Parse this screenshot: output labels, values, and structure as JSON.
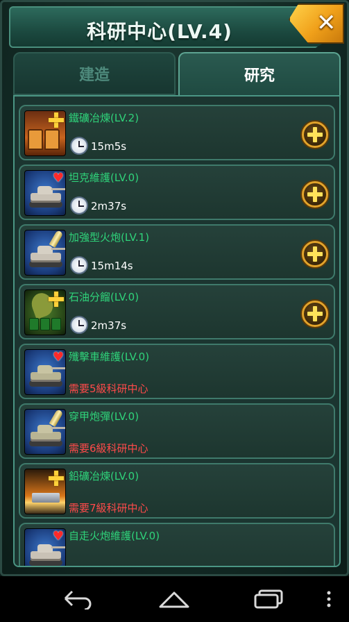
{
  "header": {
    "title": "科研中心(LV.4)",
    "close_icon": "close-icon"
  },
  "tabs": [
    {
      "label": "建造",
      "active": false
    },
    {
      "label": "研究",
      "active": true
    }
  ],
  "items": [
    {
      "name": "鐵礦冶煉(LV.2)",
      "time": "15m5s",
      "requirement": "",
      "icon": "iron-smelting-icon",
      "badge": "plus"
    },
    {
      "name": "坦克維護(LV.0)",
      "time": "2m37s",
      "requirement": "",
      "icon": "tank-icon",
      "badge": "heart"
    },
    {
      "name": "加強型火炮(LV.1)",
      "time": "15m14s",
      "requirement": "",
      "icon": "tank-cannon-icon",
      "badge": "shell"
    },
    {
      "name": "石油分餾(LV.0)",
      "time": "2m37s",
      "requirement": "",
      "icon": "oil-refining-icon",
      "badge": "plus"
    },
    {
      "name": "殲擊車維護(LV.0)",
      "time": "",
      "requirement": "需要5級科研中心",
      "icon": "tank-destroyer-icon",
      "badge": "heart"
    },
    {
      "name": "穿甲炮彈(LV.0)",
      "time": "",
      "requirement": "需要6級科研中心",
      "icon": "armor-piercing-icon",
      "badge": "shell"
    },
    {
      "name": "鉛礦冶煉(LV.0)",
      "time": "",
      "requirement": "需要7級科研中心",
      "icon": "lead-smelting-icon",
      "badge": "plus"
    },
    {
      "name": "自走火炮維護(LV.0)",
      "time": "",
      "requirement": "",
      "icon": "self-propelled-gun-icon",
      "badge": "heart"
    }
  ],
  "colors": {
    "item_name": "#2fd37a",
    "requirement": "#ff4a4a",
    "accent_gold": "#e2a32a"
  },
  "navbar": {
    "back": "back-icon",
    "home": "home-icon",
    "recent": "recent-apps-icon",
    "menu": "overflow-menu-icon"
  }
}
